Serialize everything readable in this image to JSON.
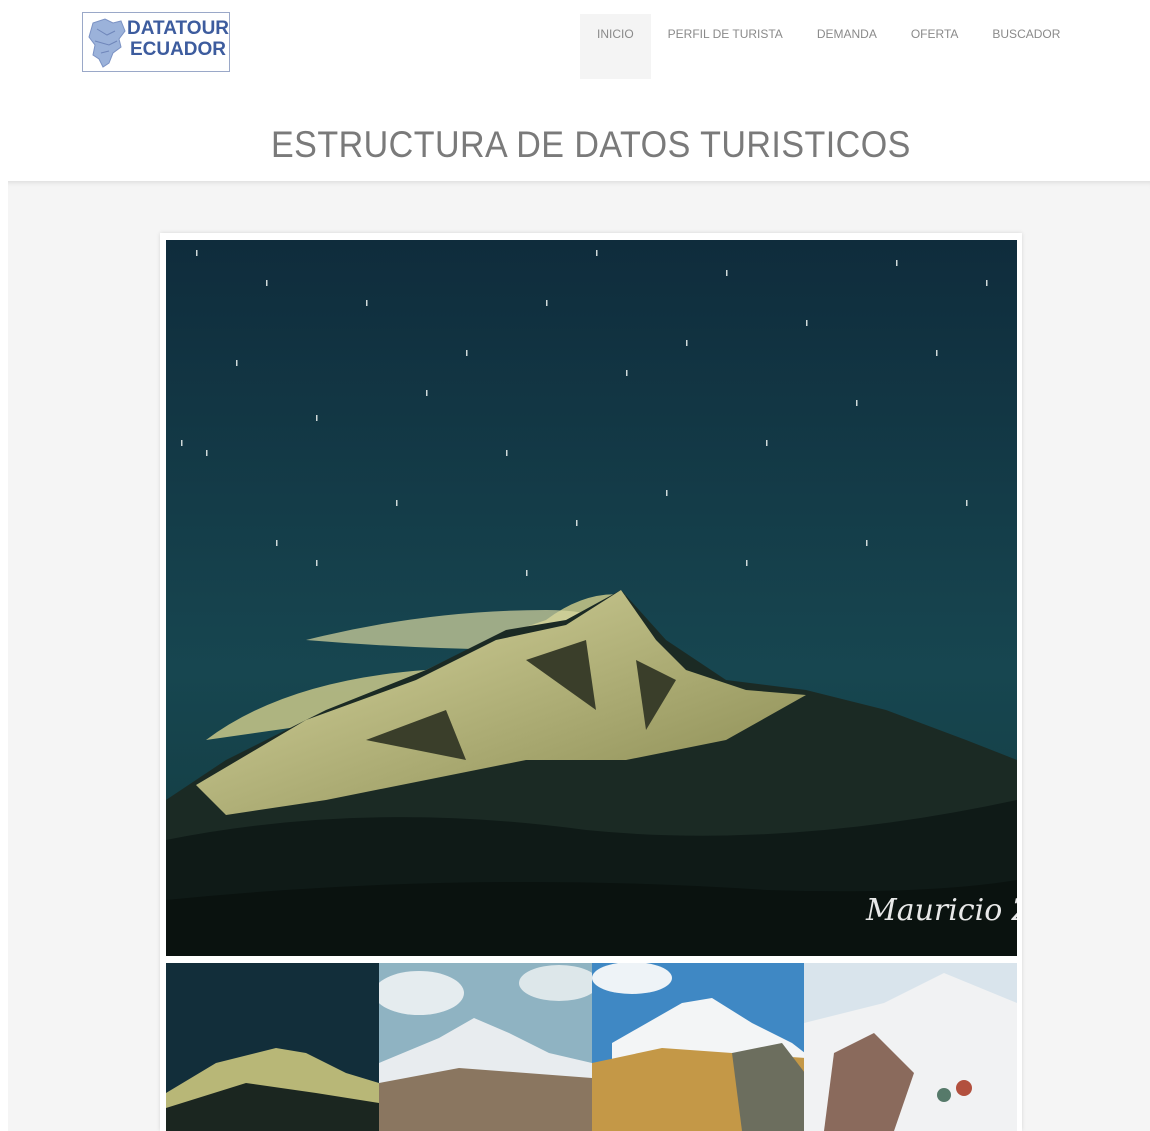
{
  "brand": {
    "line1": "DATATOUR",
    "line2": "ECUADOR",
    "color": "#3d5c9e"
  },
  "nav": {
    "items": [
      {
        "label": "INICIO",
        "active": true
      },
      {
        "label": "PERFIL DE TURISTA",
        "active": false
      },
      {
        "label": "DEMANDA",
        "active": false
      },
      {
        "label": "OFERTA",
        "active": false
      },
      {
        "label": "BUSCADOR",
        "active": false
      }
    ]
  },
  "page": {
    "title": "ESTRUCTURA DE DATOS TURISTICOS"
  },
  "gallery": {
    "main_signature": "Mauricio Z",
    "thumbnails": [
      "night-mountain",
      "snow-peak-blue-sky",
      "snow-peak-golden-hills",
      "hikers-snow-slope"
    ]
  }
}
